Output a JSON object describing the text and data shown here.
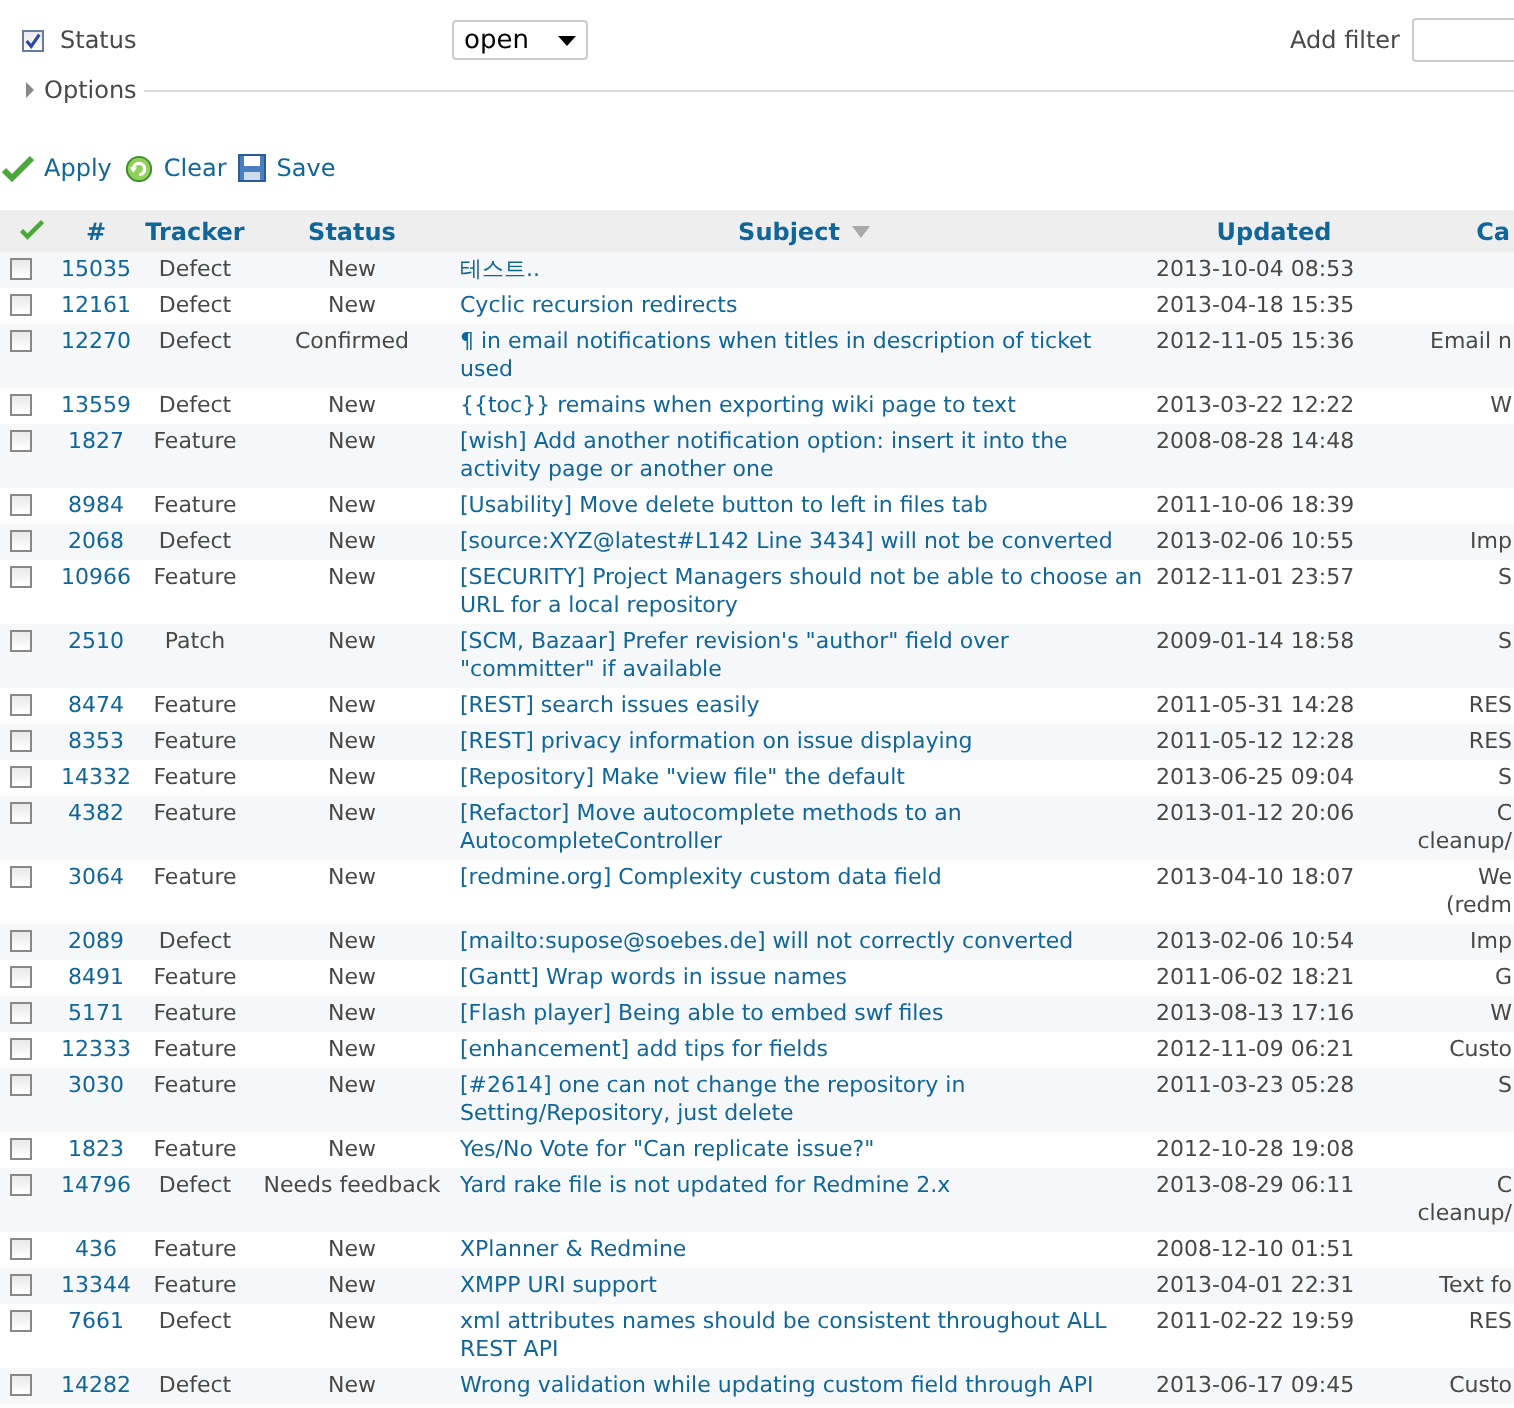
{
  "filters": {
    "status": {
      "label": "Status",
      "checked": true,
      "operator": "open"
    },
    "add_filter": {
      "label": "Add filter"
    }
  },
  "options": {
    "label": "Options",
    "expanded": false
  },
  "actions": [
    {
      "kind": "apply",
      "label": "Apply"
    },
    {
      "kind": "clear",
      "label": "Clear"
    },
    {
      "kind": "save",
      "label": "Save"
    }
  ],
  "table": {
    "columns": [
      {
        "label": "#",
        "sorted": false
      },
      {
        "label": "Tracker",
        "sorted": false
      },
      {
        "label": "Status",
        "sorted": false
      },
      {
        "label": "Subject",
        "sorted": true
      },
      {
        "label": "Updated",
        "sorted": false
      },
      {
        "label": "Ca",
        "sorted": false
      }
    ],
    "rows": [
      {
        "checked": false,
        "id": "15035",
        "tracker": "Defect",
        "status": "New",
        "subject": "테스트..",
        "updated": "2013-10-04 08:53",
        "category": ""
      },
      {
        "checked": false,
        "id": "12161",
        "tracker": "Defect",
        "status": "New",
        "subject": "Cyclic recursion redirects",
        "updated": "2013-04-18 15:35",
        "category": ""
      },
      {
        "checked": false,
        "id": "12270",
        "tracker": "Defect",
        "status": "Confirmed",
        "subject": "¶ in email notifications when titles in description of ticket used",
        "updated": "2012-11-05 15:36",
        "category": "Email n"
      },
      {
        "checked": false,
        "id": "13559",
        "tracker": "Defect",
        "status": "New",
        "subject": "{{toc}} remains when exporting wiki page to text",
        "updated": "2013-03-22 12:22",
        "category": "W"
      },
      {
        "checked": false,
        "id": "1827",
        "tracker": "Feature",
        "status": "New",
        "subject": "[wish] Add another notification option: insert it into the activity page or another one",
        "updated": "2008-08-28 14:48",
        "category": ""
      },
      {
        "checked": false,
        "id": "8984",
        "tracker": "Feature",
        "status": "New",
        "subject": "[Usability] Move delete button to left in files tab",
        "updated": "2011-10-06 18:39",
        "category": ""
      },
      {
        "checked": false,
        "id": "2068",
        "tracker": "Defect",
        "status": "New",
        "subject": "[source:XYZ@latest#L142 Line 3434] will not be converted",
        "updated": "2013-02-06 10:55",
        "category": "Imp"
      },
      {
        "checked": false,
        "id": "10966",
        "tracker": "Feature",
        "status": "New",
        "subject": "[SECURITY] Project Managers should not be able to choose an URL for a local repository",
        "updated": "2012-11-01 23:57",
        "category": "S"
      },
      {
        "checked": false,
        "id": "2510",
        "tracker": "Patch",
        "status": "New",
        "subject": "[SCM, Bazaar] Prefer revision's \"author\" field over \"committer\" if available",
        "updated": "2009-01-14 18:58",
        "category": "S"
      },
      {
        "checked": false,
        "id": "8474",
        "tracker": "Feature",
        "status": "New",
        "subject": "[REST] search issues easily",
        "updated": "2011-05-31 14:28",
        "category": "RES"
      },
      {
        "checked": false,
        "id": "8353",
        "tracker": "Feature",
        "status": "New",
        "subject": "[REST] privacy information on issue displaying",
        "updated": "2011-05-12 12:28",
        "category": "RES"
      },
      {
        "checked": false,
        "id": "14332",
        "tracker": "Feature",
        "status": "New",
        "subject": "[Repository] Make \"view file\" the default",
        "updated": "2013-06-25 09:04",
        "category": "S"
      },
      {
        "checked": false,
        "id": "4382",
        "tracker": "Feature",
        "status": "New",
        "subject": "[Refactor] Move autocomplete methods to an AutocompleteController",
        "updated": "2013-01-12 20:06",
        "category": "C\ncleanup/"
      },
      {
        "checked": false,
        "id": "3064",
        "tracker": "Feature",
        "status": "New",
        "subject": "[redmine.org] Complexity custom data field",
        "updated": "2013-04-10 18:07",
        "category": "We\n(redm"
      },
      {
        "checked": false,
        "id": "2089",
        "tracker": "Defect",
        "status": "New",
        "subject": "[mailto:supose@soebes.de] will not correctly converted",
        "updated": "2013-02-06 10:54",
        "category": "Imp"
      },
      {
        "checked": false,
        "id": "8491",
        "tracker": "Feature",
        "status": "New",
        "subject": "[Gantt] Wrap words in issue names",
        "updated": "2011-06-02 18:21",
        "category": "G"
      },
      {
        "checked": false,
        "id": "5171",
        "tracker": "Feature",
        "status": "New",
        "subject": "[Flash player] Being able to embed swf files",
        "updated": "2013-08-13 17:16",
        "category": "W"
      },
      {
        "checked": false,
        "id": "12333",
        "tracker": "Feature",
        "status": "New",
        "subject": "[enhancement] add tips for fields",
        "updated": "2012-11-09 06:21",
        "category": "Custo"
      },
      {
        "checked": false,
        "id": "3030",
        "tracker": "Feature",
        "status": "New",
        "subject": "[#2614] one can not change the repository in Setting/Repository, just delete",
        "updated": "2011-03-23 05:28",
        "category": "S"
      },
      {
        "checked": false,
        "id": "1823",
        "tracker": "Feature",
        "status": "New",
        "subject": "Yes/No Vote for \"Can replicate issue?\"",
        "updated": "2012-10-28 19:08",
        "category": ""
      },
      {
        "checked": false,
        "id": "14796",
        "tracker": "Defect",
        "status": "Needs feedback",
        "subject": "Yard rake file is not updated for Redmine 2.x",
        "updated": "2013-08-29 06:11",
        "category": "C\ncleanup/"
      },
      {
        "checked": false,
        "id": "436",
        "tracker": "Feature",
        "status": "New",
        "subject": "XPlanner & Redmine",
        "updated": "2008-12-10 01:51",
        "category": ""
      },
      {
        "checked": false,
        "id": "13344",
        "tracker": "Feature",
        "status": "New",
        "subject": "XMPP URI support",
        "updated": "2013-04-01 22:31",
        "category": "Text fo"
      },
      {
        "checked": false,
        "id": "7661",
        "tracker": "Defect",
        "status": "New",
        "subject": "xml attributes names should be consistent throughout ALL REST API",
        "updated": "2011-02-22 19:59",
        "category": "RES"
      },
      {
        "checked": false,
        "id": "14282",
        "tracker": "Defect",
        "status": "New",
        "subject": "Wrong validation while updating custom field through API",
        "updated": "2013-06-17 09:45",
        "category": "Custo"
      }
    ]
  }
}
